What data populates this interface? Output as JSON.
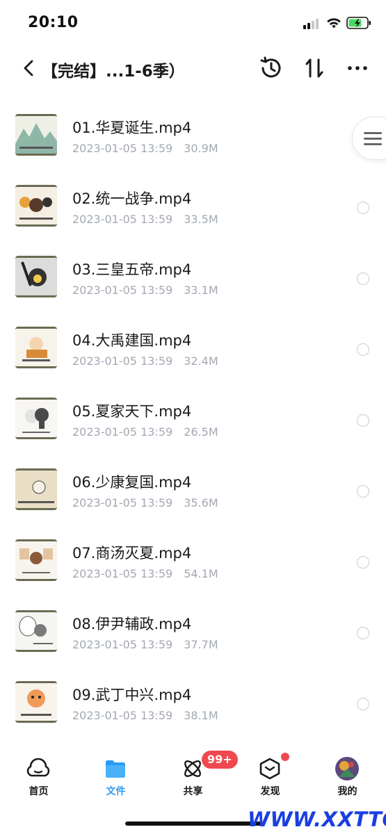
{
  "status": {
    "time": "20:10"
  },
  "header": {
    "title": "【完结】...1-6季）"
  },
  "files": [
    {
      "name": "01.华夏诞生.mp4",
      "date": "2023-01-05 13:59",
      "size": "30.9M"
    },
    {
      "name": "02.统一战争.mp4",
      "date": "2023-01-05 13:59",
      "size": "33.5M"
    },
    {
      "name": "03.三皇五帝.mp4",
      "date": "2023-01-05 13:59",
      "size": "33.1M"
    },
    {
      "name": "04.大禹建国.mp4",
      "date": "2023-01-05 13:59",
      "size": "32.4M"
    },
    {
      "name": "05.夏家天下.mp4",
      "date": "2023-01-05 13:59",
      "size": "26.5M"
    },
    {
      "name": "06.少康复国.mp4",
      "date": "2023-01-05 13:59",
      "size": "35.6M"
    },
    {
      "name": "07.商汤灭夏.mp4",
      "date": "2023-01-05 13:59",
      "size": "54.1M"
    },
    {
      "name": "08.伊尹辅政.mp4",
      "date": "2023-01-05 13:59",
      "size": "37.7M"
    },
    {
      "name": "09.武丁中兴.mp4",
      "date": "2023-01-05 13:59",
      "size": "38.1M"
    }
  ],
  "tabbar": {
    "tabs": [
      {
        "label": "首页",
        "icon": "home-cloud-icon"
      },
      {
        "label": "文件",
        "icon": "folder-icon",
        "active": true
      },
      {
        "label": "共享",
        "icon": "share-atom-icon"
      },
      {
        "label": "发现",
        "icon": "discover-box-icon"
      },
      {
        "label": "我的",
        "icon": "avatar-icon"
      }
    ],
    "share_badge": "99+"
  },
  "watermark": "WWW.XXTTQ.COM",
  "colors": {
    "accent": "#2b9bf5",
    "badge": "#f0484f",
    "meta": "#a3a8b3"
  }
}
